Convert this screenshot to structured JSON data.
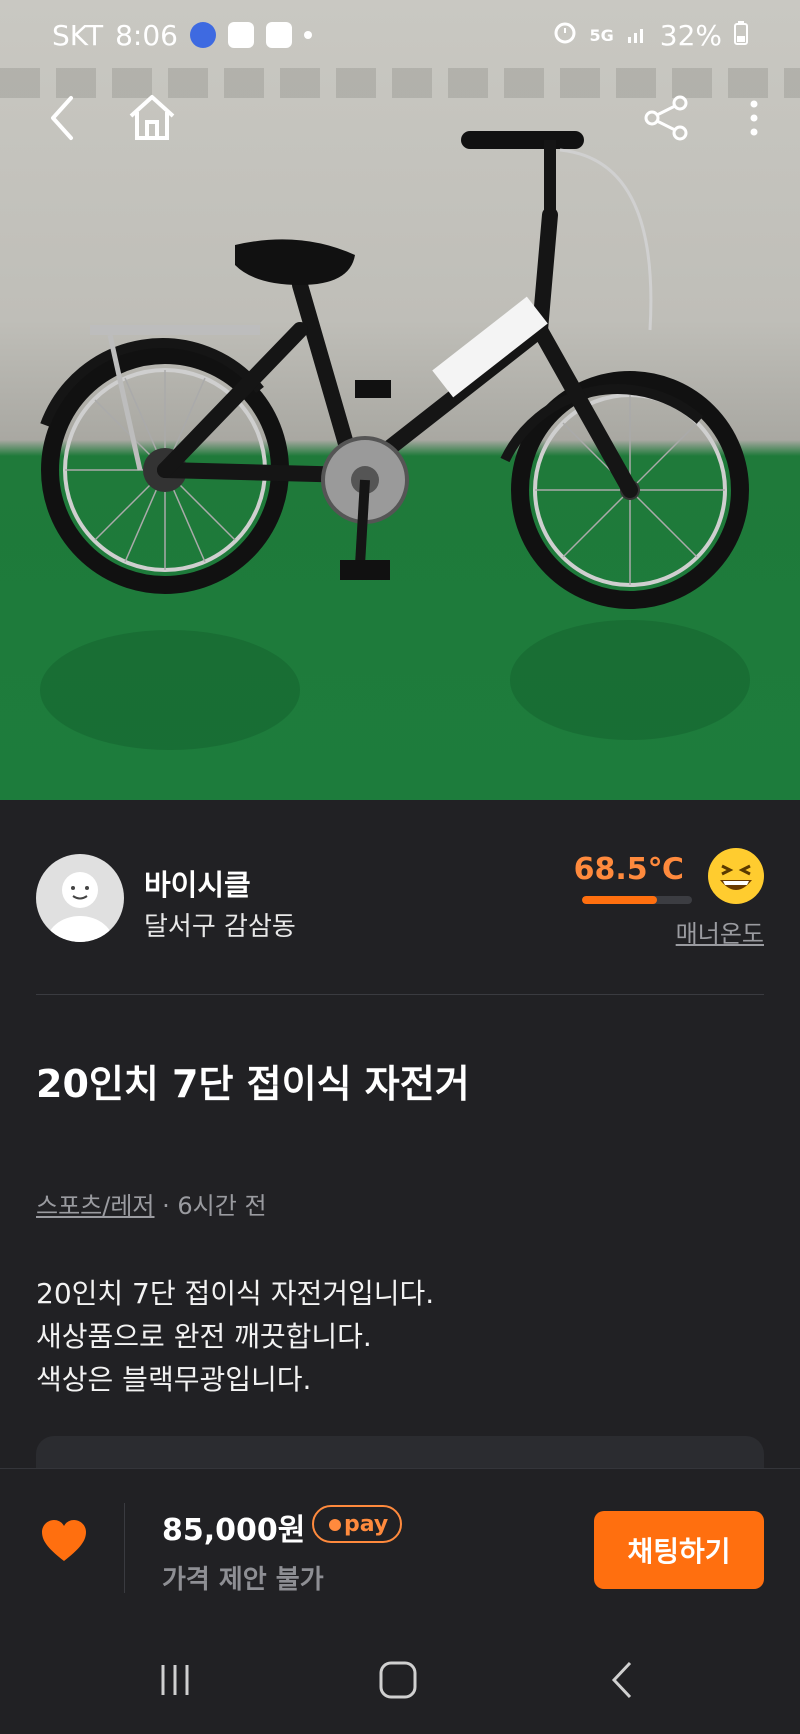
{
  "status_bar": {
    "carrier": "SKT",
    "time": "8:06",
    "network": "5G",
    "battery": "32%"
  },
  "colors": {
    "accent": "#ff6f0f",
    "temp_text": "#ff8a3d",
    "background": "#212124"
  },
  "nav_icons": [
    "back-icon",
    "home-icon",
    "share-icon",
    "more-icon"
  ],
  "seller": {
    "name": "바이시클",
    "location": "달서구 감삼동",
    "temperature": "68.5℃",
    "temperature_progress": 0.685,
    "manner_label": "매너온도"
  },
  "listing": {
    "title": "20인치 7단 접이식 자전거",
    "category": "스포츠/레저",
    "time_ago": " · 6시간 전",
    "description": "20인치 7단 접이식 자전거입니다.\n새상품으로 완전 깨끗합니다.\n색상은 블랙무광입니다."
  },
  "action_bar": {
    "price": "85,000원",
    "pay_badge": "pay",
    "negotiation": "가격 제안 불가",
    "chat_button": "채팅하기"
  }
}
